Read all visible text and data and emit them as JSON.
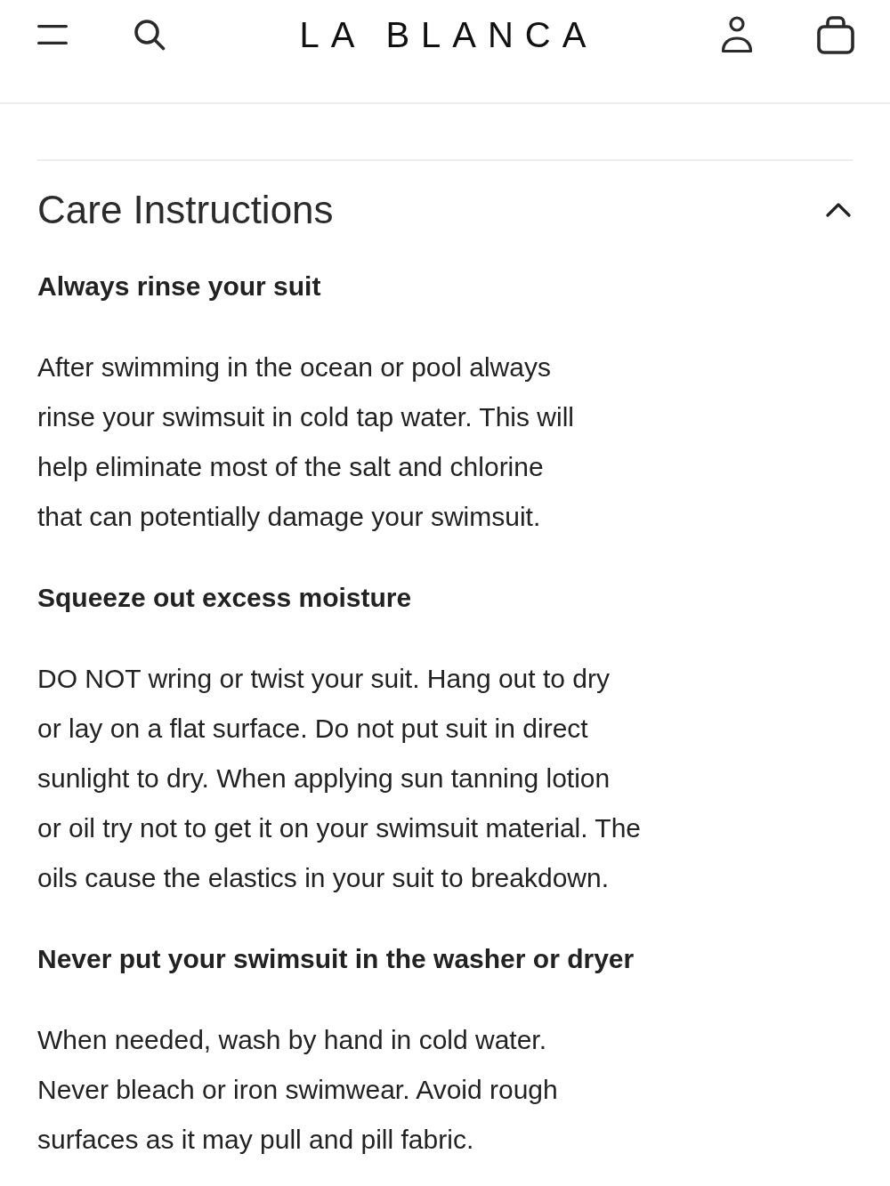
{
  "header": {
    "logo": "LA BLANCA"
  },
  "accordion": {
    "title": "Care Instructions",
    "expanded": true,
    "sections": [
      {
        "heading": "Always rinse your suit",
        "body": "After swimming in the ocean or pool always\nrinse your swimsuit in cold tap water. This will\nhelp eliminate most of the salt and chlorine\nthat can potentially damage your swimsuit."
      },
      {
        "heading": "Squeeze out excess moisture",
        "body": "DO NOT wring or twist your suit. Hang out to dry\nor lay on a flat surface. Do not put suit in direct\nsunlight to dry. When applying sun tanning lotion\nor oil try not to get it on your swimsuit material. The\noils cause the elastics in your suit to breakdown."
      },
      {
        "heading": "Never put your swimsuit in the washer or dryer",
        "body": "When needed, wash by hand in cold water.\nNever bleach or iron swimwear. Avoid rough\nsurfaces as it may pull and pill fabric."
      }
    ]
  }
}
